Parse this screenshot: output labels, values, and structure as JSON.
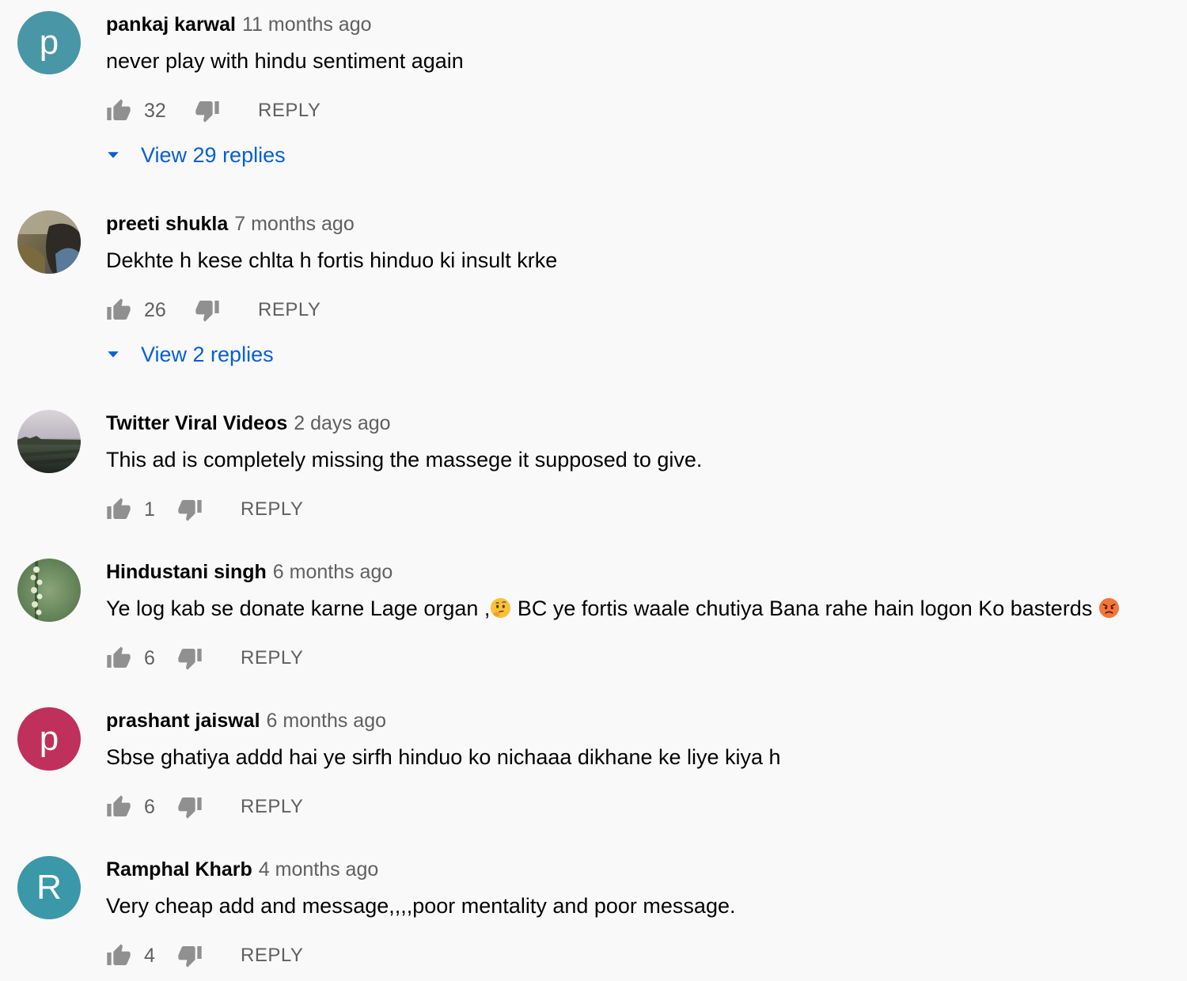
{
  "comments": [
    {
      "author": "pankaj karwal",
      "time": "11 months ago",
      "text": "never play with hindu sentiment again",
      "likes": "32",
      "reply_label": "REPLY",
      "view_replies": "View 29 replies",
      "avatar": {
        "type": "letter",
        "letter": "p",
        "color": "#4896a6"
      }
    },
    {
      "author": "preeti shukla",
      "time": "7 months ago",
      "text": "Dekhte h kese chlta h fortis hinduo ki insult krke",
      "likes": "26",
      "reply_label": "REPLY",
      "view_replies": "View 2 replies",
      "avatar": {
        "type": "photo",
        "icon": "profile-photo"
      }
    },
    {
      "author": "Twitter Viral Videos",
      "time": "2 days ago",
      "text": "This ad is completely missing the massege it supposed to give.",
      "likes": "1",
      "reply_label": "REPLY",
      "avatar": {
        "type": "photo",
        "icon": "landscape-photo"
      }
    },
    {
      "author": "Hindustani singh",
      "time": "6 months ago",
      "text_part1": "Ye log kab se donate karne Lage organ ,",
      "text_part2": " BC ye fortis waale chutiya Bana rahe hain  logon Ko basterds ",
      "likes": "6",
      "reply_label": "REPLY",
      "avatar": {
        "type": "photo",
        "icon": "plant-photo"
      },
      "emojis": [
        "thinking-face-emoji",
        "angry-face-emoji"
      ]
    },
    {
      "author": "prashant jaiswal",
      "time": "6 months ago",
      "text": "Sbse ghatiya addd hai ye sirfh hinduo ko nichaaa dikhane ke liye kiya h",
      "likes": "6",
      "reply_label": "REPLY",
      "avatar": {
        "type": "letter",
        "letter": "p",
        "color": "#c0305c"
      }
    },
    {
      "author": "Ramphal Kharb",
      "time": "4 months ago",
      "text": "Very cheap add and message,,,,poor mentality and poor message.",
      "likes": "4",
      "reply_label": "REPLY",
      "avatar": {
        "type": "letter",
        "letter": "R",
        "color": "#3a98a8"
      }
    }
  ],
  "colors": {
    "background": "#f9f9f9",
    "link": "#065fd4",
    "secondary_text": "#606060",
    "icon": "#909090"
  }
}
